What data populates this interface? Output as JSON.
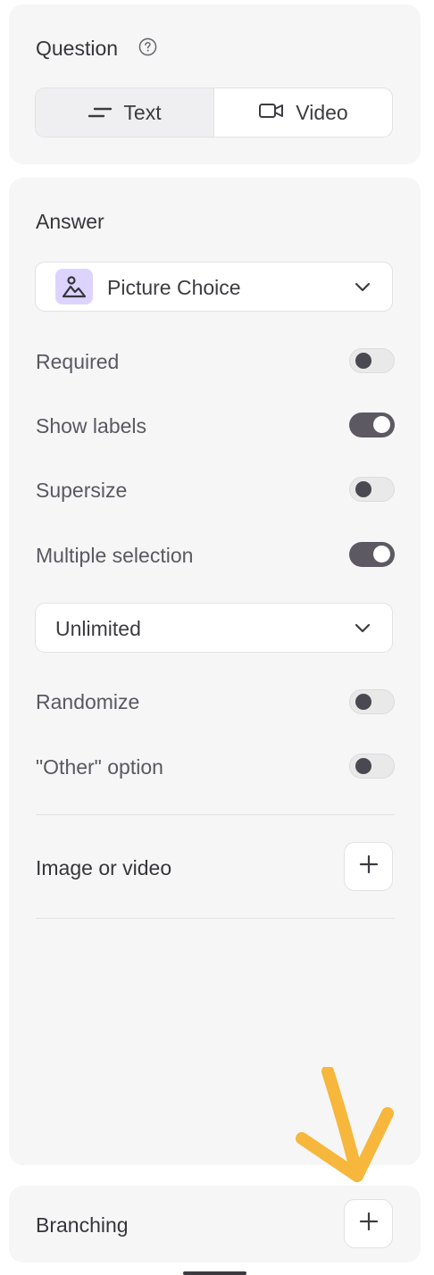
{
  "question": {
    "title": "Question",
    "help_icon": "question-circle-icon",
    "tabs": [
      {
        "label": "Text",
        "icon": "text-lines-icon",
        "active": true
      },
      {
        "label": "Video",
        "icon": "video-camera-icon",
        "active": false
      }
    ]
  },
  "answer": {
    "title": "Answer",
    "type_select": {
      "value": "Picture Choice",
      "icon": "image-icon",
      "icon_bg": "#dcd4ff"
    },
    "settings": [
      {
        "label": "Required",
        "on": false
      },
      {
        "label": "Show labels",
        "on": true
      },
      {
        "label": "Supersize",
        "on": false
      },
      {
        "label": "Multiple selection",
        "on": true
      }
    ],
    "selection_limit": {
      "value": "Unlimited"
    },
    "settings_more": [
      {
        "label": "Randomize",
        "on": false
      },
      {
        "label": "\"Other\" option",
        "on": false
      }
    ],
    "media": {
      "label": "Image or video"
    }
  },
  "branching": {
    "label": "Branching"
  },
  "colors": {
    "card_bg": "#f6f6f6",
    "toggle_on": "#5c5963",
    "arrow": "#f6b73c"
  }
}
